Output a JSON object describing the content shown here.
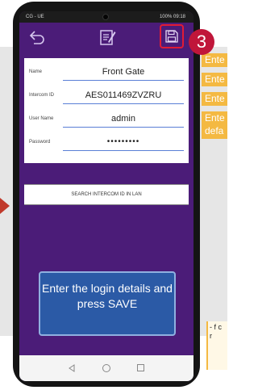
{
  "status_bar": {
    "carrier": "CG - UE",
    "battery": "100%",
    "time": "09:18"
  },
  "step_number": "3",
  "form": {
    "fields": [
      {
        "label": "Name",
        "value": "Front Gate"
      },
      {
        "label": "Intercom ID",
        "value": "AES011469ZVZRU"
      },
      {
        "label": "User Name",
        "value": "admin"
      },
      {
        "label": "Password",
        "value": "•••••••••"
      }
    ]
  },
  "search_button_label": "SEARCH INTERCOM ID IN LAN",
  "instruction_text": "Enter the login details and press SAVE",
  "callouts": [
    "Ente",
    "Ente",
    "Ente",
    "Ente defa"
  ],
  "note_text": "- f c r",
  "colors": {
    "app_purple": "#4b1c78",
    "highlight_red": "#e11b35",
    "badge_red": "#c0163a",
    "callout_orange": "#f4b942",
    "instruction_blue": "#2b5aa6"
  },
  "icons": {
    "back": "back-arrow-icon",
    "edit": "edit-note-icon",
    "save": "floppy-disk-icon"
  }
}
